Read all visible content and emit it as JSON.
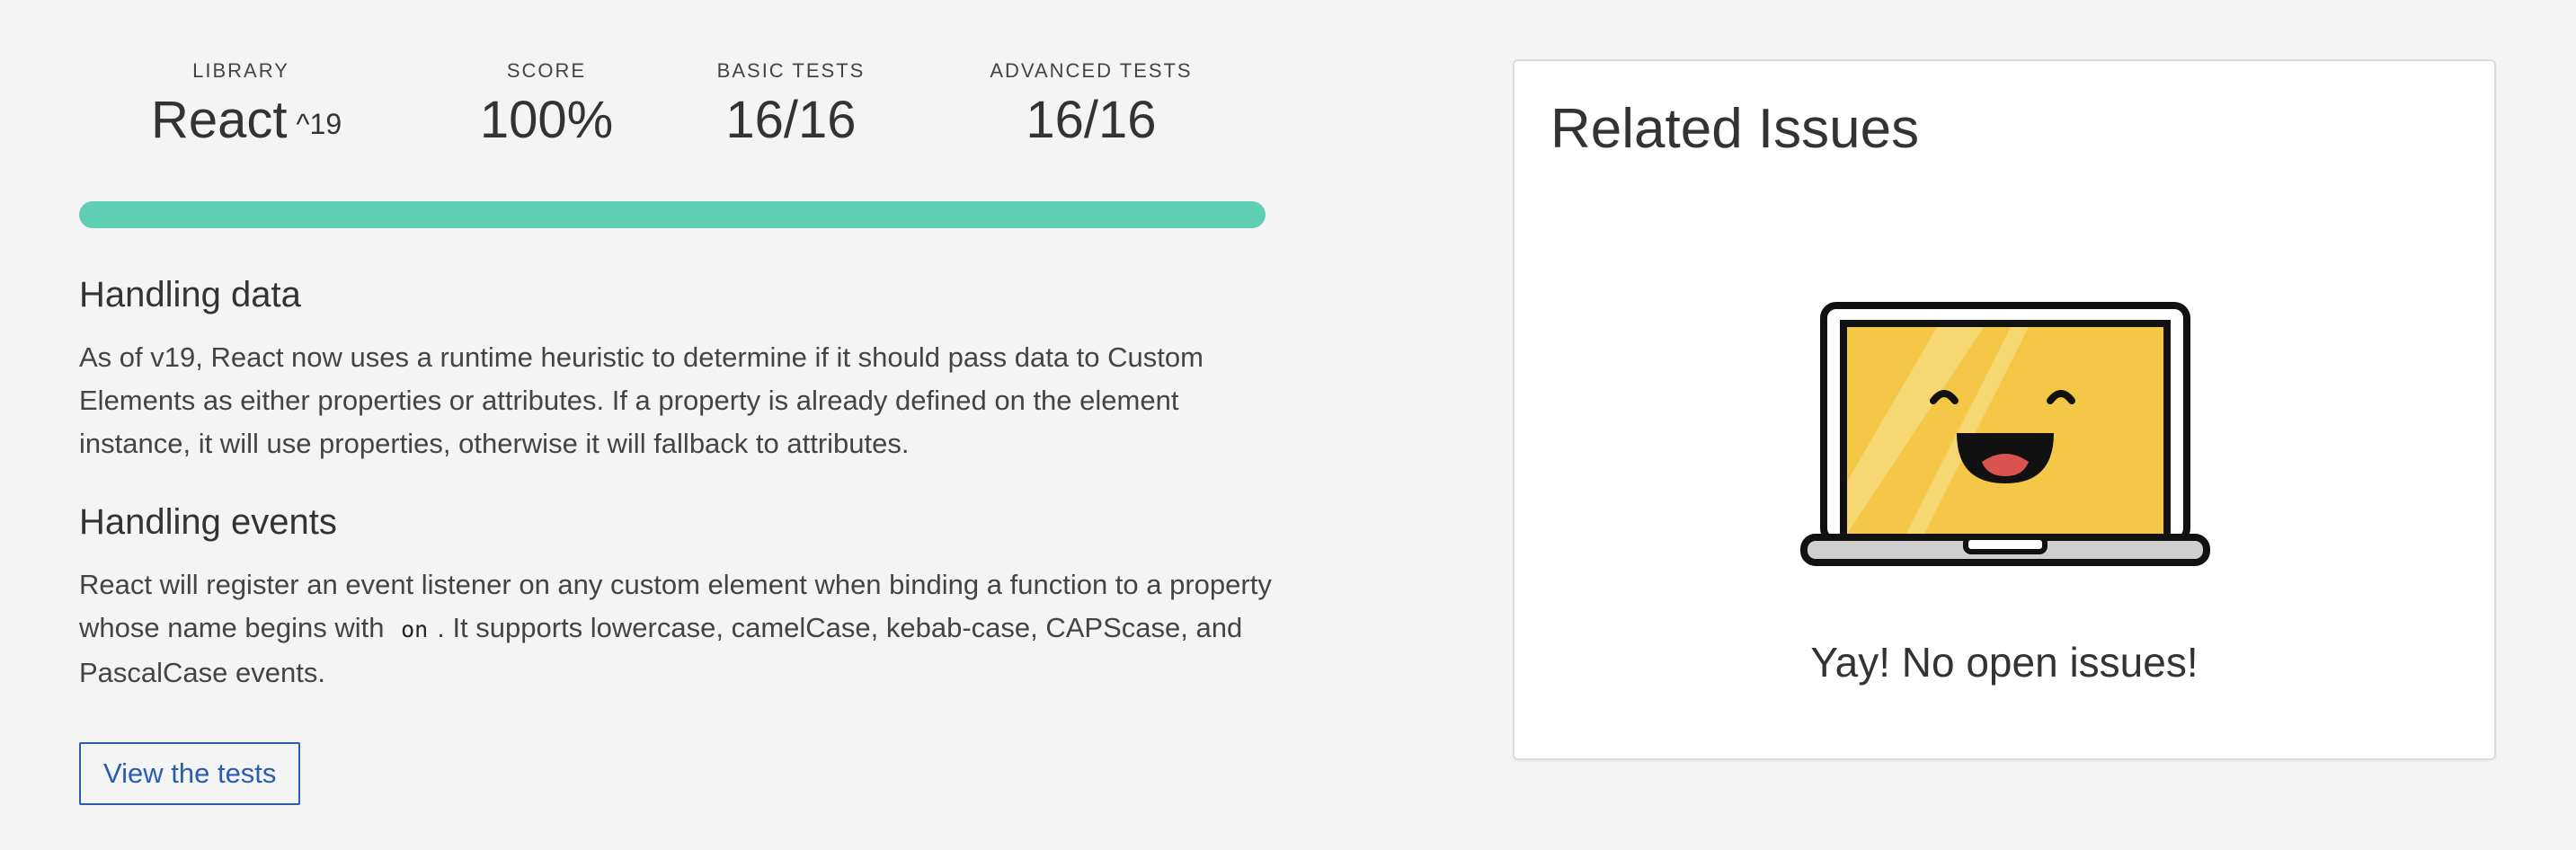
{
  "stats": {
    "library": {
      "label": "Library",
      "value": "React",
      "version": "^19"
    },
    "score": {
      "label": "Score",
      "value": "100%"
    },
    "basic": {
      "label": "Basic Tests",
      "value": "16/16"
    },
    "advanced": {
      "label": "Advanced Tests",
      "value": "16/16"
    }
  },
  "progress": {
    "fraction": 1.0,
    "color": "#5fcfb3"
  },
  "sections": {
    "data": {
      "title": "Handling data",
      "body": "As of v19, React now uses a runtime heuristic to determine if it should pass data to Custom Elements as either properties or attributes. If a property is already defined on the element instance, it will use properties, otherwise it will fallback to attributes."
    },
    "events": {
      "title": "Handling events",
      "body_before": "React will register an event listener on any custom element when binding a function to a property whose name begins with",
      "code": "on",
      "body_after": ". It supports lowercase, camelCase, kebab-case, CAPScase, and PascalCase events."
    }
  },
  "view_tests_label": "View the tests",
  "issues": {
    "title": "Related Issues",
    "empty_message": "Yay! No open issues!",
    "illustration_icon": "happy-laptop-icon"
  },
  "colors": {
    "accent": "#5fcfb3",
    "link": "#2a5db0",
    "laptop_screen": "#f5c747"
  }
}
